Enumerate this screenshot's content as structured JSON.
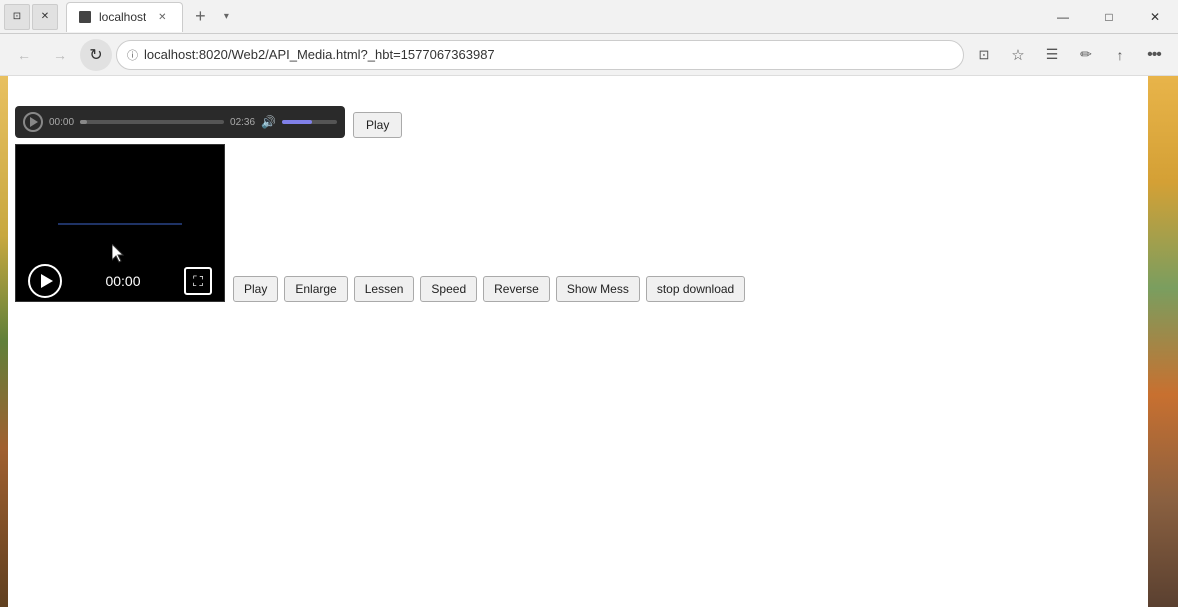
{
  "browser": {
    "tab_title": "localhost",
    "tab_favicon": "browser-tab",
    "address": "localhost:8020/Web2/API_Media.html?_hbt=1577067363987",
    "new_tab_label": "+",
    "tab_list_label": "▾"
  },
  "window_controls": {
    "minimize": "—",
    "maximize": "□",
    "close": "✕"
  },
  "nav": {
    "back_label": "←",
    "forward_label": "→",
    "refresh_label": "↻",
    "home_label": "⌂",
    "lock_icon": "ⓘ",
    "favorites_label": "☆",
    "hub_label": "☰",
    "notes_label": "✏",
    "share_label": "↑",
    "more_label": "…"
  },
  "audio_player": {
    "play_icon": "play",
    "current_time": "00:00",
    "duration": "02:36",
    "progress_pct": 5,
    "volume_pct": 55
  },
  "video_player": {
    "time_display": "00:00"
  },
  "buttons": {
    "audio_play": "Play",
    "video_play": "Play",
    "enlarge": "Enlarge",
    "lessen": "Lessen",
    "speed": "Speed",
    "reverse": "Reverse",
    "show_mess": "Show Mess",
    "stop_download": "stop download"
  }
}
